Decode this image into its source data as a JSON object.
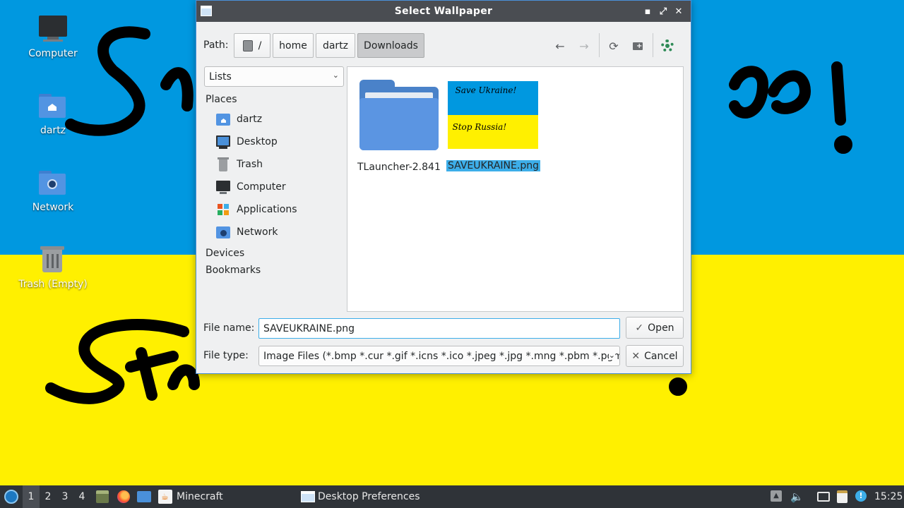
{
  "desktop": {
    "icons": [
      {
        "label": "Computer"
      },
      {
        "label": "dartz"
      },
      {
        "label": "Network"
      },
      {
        "label": "Trash (Empty)"
      }
    ],
    "colors": {
      "wallpaper_top": "#0098e0",
      "wallpaper_bottom": "#fff000",
      "scribble": "#000000"
    }
  },
  "dialog": {
    "title": "Select Wallpaper",
    "window_buttons": {
      "minimize": "▪",
      "maximize": "⤢",
      "close": "✕"
    },
    "path": {
      "label": "Path:",
      "crumbs": [
        {
          "label": "/",
          "icon": "drive-icon"
        },
        {
          "label": "home"
        },
        {
          "label": "dartz"
        },
        {
          "label": "Downloads",
          "active": true
        }
      ],
      "nav_icons": [
        "back-arrow-icon",
        "forward-arrow-icon",
        "reload-icon",
        "new-folder-icon",
        "options-icon"
      ]
    },
    "view_mode": "Lists",
    "places": {
      "heading": "Places",
      "items": [
        {
          "label": "dartz",
          "icon": "home-folder-icon"
        },
        {
          "label": "Desktop",
          "icon": "desktop-icon"
        },
        {
          "label": "Trash",
          "icon": "trash-icon"
        },
        {
          "label": "Computer",
          "icon": "computer-icon"
        },
        {
          "label": "Applications",
          "icon": "applications-icon"
        },
        {
          "label": "Network",
          "icon": "network-folder-icon"
        }
      ],
      "devices": "Devices",
      "bookmarks": "Bookmarks"
    },
    "files": [
      {
        "name": "TLauncher-2.841",
        "type": "folder"
      },
      {
        "name": "SAVEUKRAINE.png",
        "type": "image",
        "selected": true,
        "thumb_text_top": "Save Ukraine!",
        "thumb_text_bottom": "Stop Russia!"
      }
    ],
    "filename_label": "File name:",
    "filename_value": "SAVEUKRAINE.png",
    "filetype_label": "File type:",
    "filetype_value": "Image Files (*.bmp *.cur *.gif *.icns *.ico *.jpeg *.jpg *.mng *.pbm *.pgm",
    "open_button": "Open",
    "cancel_button": "Cancel",
    "accent": "#3daee9"
  },
  "taskbar": {
    "workspaces": [
      "1",
      "2",
      "3",
      "4"
    ],
    "tasks": [
      {
        "label": "Minecraft",
        "icon": "java-icon"
      },
      {
        "label": "Desktop Preferences",
        "icon": "window-icon"
      }
    ],
    "clock": "15:25"
  }
}
